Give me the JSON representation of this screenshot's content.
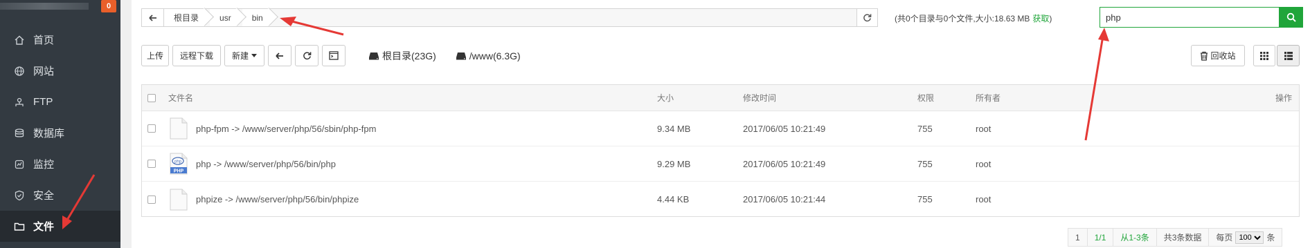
{
  "sidebar": {
    "badge": "0",
    "items": [
      {
        "label": "首页",
        "icon": "home-icon"
      },
      {
        "label": "网站",
        "icon": "globe-icon"
      },
      {
        "label": "FTP",
        "icon": "ftp-icon"
      },
      {
        "label": "数据库",
        "icon": "database-icon"
      },
      {
        "label": "监控",
        "icon": "monitor-icon"
      },
      {
        "label": "安全",
        "icon": "shield-icon"
      },
      {
        "label": "文件",
        "icon": "folder-icon",
        "active": true
      }
    ]
  },
  "path": {
    "crumbs": [
      "根目录",
      "usr",
      "bin"
    ]
  },
  "summary": {
    "text": "(共0个目录与0个文件,大小:18.63 MB",
    "fetch": "获取",
    "close": ")"
  },
  "search": {
    "value": "php"
  },
  "toolbar": {
    "upload": "上传",
    "remote_download": "远程下载",
    "new": "新建",
    "disk_root": "根目录(23G)",
    "disk_www": "/www(6.3G)",
    "recycle": "回收站"
  },
  "table": {
    "headers": {
      "name": "文件名",
      "size": "大小",
      "mtime": "修改时间",
      "perm": "权限",
      "owner": "所有者",
      "actions": "操作"
    },
    "rows": [
      {
        "name": "php-fpm -> /www/server/php/56/sbin/php-fpm",
        "size": "9.34 MB",
        "mtime": "2017/06/05 10:21:49",
        "perm": "755",
        "owner": "root",
        "icon": "file-icon"
      },
      {
        "name": "php -> /www/server/php/56/bin/php",
        "size": "9.29 MB",
        "mtime": "2017/06/05 10:21:49",
        "perm": "755",
        "owner": "root",
        "icon": "php-file-icon",
        "icon_label": "PHP",
        "icon_text": "php"
      },
      {
        "name": "phpize -> /www/server/php/56/bin/phpize",
        "size": "4.44 KB",
        "mtime": "2017/06/05 10:21:44",
        "perm": "755",
        "owner": "root",
        "icon": "file-icon"
      }
    ]
  },
  "pagination": {
    "page": "1",
    "pages": "1/1",
    "range": "从1-3条",
    "total": "共3条数据",
    "per_page_label": "每页",
    "per_page_value": "100",
    "unit": "条"
  },
  "colors": {
    "accent": "#20a53a",
    "sidebar_bg": "#333a41",
    "annotation": "#e53935"
  }
}
